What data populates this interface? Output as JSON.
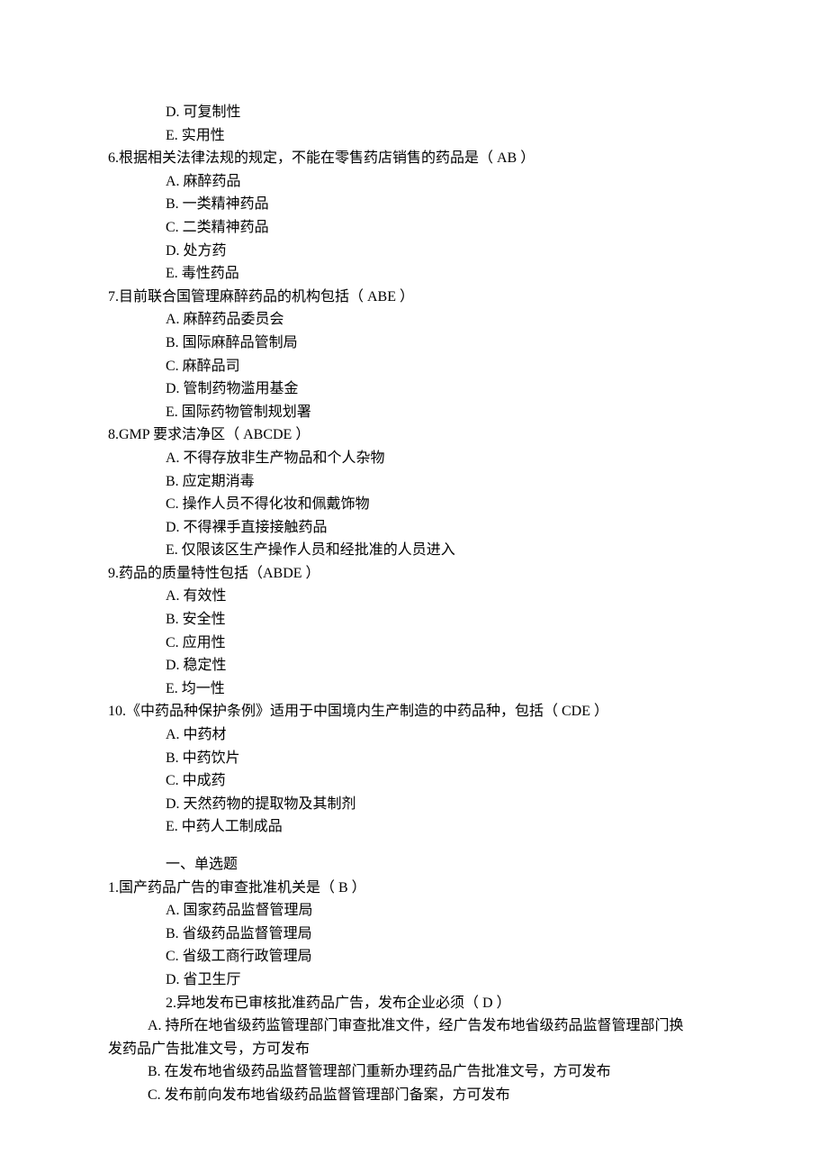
{
  "q_cont": {
    "opts": {
      "D": "D.  可复制性",
      "E": "E.  实用性"
    }
  },
  "q6": {
    "stem_num": "6.",
    "stem_rest": "根据相关法律法规的规定，不能在零售药店销售的药品是（    AB      ）",
    "opts": {
      "A": "A.  麻醉药品",
      "B": "B.  一类精神药品",
      "C": "C.  二类精神药品",
      "D": "D.  处方药",
      "E": "E.  毒性药品"
    }
  },
  "q7": {
    "stem_num": "7.",
    "stem_rest": "目前联合国管理麻醉药品的机构包括（  ABE   ）",
    "opts": {
      "A": "A.  麻醉药品委员会",
      "B": "B.  国际麻醉品管制局",
      "C": "C.  麻醉品司",
      "D": "D.  管制药物滥用基金",
      "E": "E.  国际药物管制规划署"
    }
  },
  "q8": {
    "stem_num": "8.",
    "stem_rest": "GMP 要求洁净区（  ABCDE    ）",
    "opts": {
      "A": "A.  不得存放非生产物品和个人杂物",
      "B": "B.  应定期消毒",
      "C": "C.  操作人员不得化妆和佩戴饰物",
      "D": "D.  不得裸手直接接触药品",
      "E": "E.  仅限该区生产操作人员和经批准的人员进入"
    }
  },
  "q9": {
    "stem_num": "9.",
    "stem_rest": "药品的质量特性包括（ABDE  ）",
    "opts": {
      "A": "A.  有效性",
      "B": "B.  安全性",
      "C": "C.  应用性",
      "D": "D.  稳定性",
      "E": "E.  均一性"
    }
  },
  "q10": {
    "stem_num": "10.",
    "stem_rest": "《中药品种保护条例》适用于中国境内生产制造的中药品种，包括（  CDE  ）",
    "opts": {
      "A": "A.  中药材",
      "B": "B.  中药饮片",
      "C": "C.  中成药",
      "D": "D.  天然药物的提取物及其制剂",
      "E": "E.  中药人工制成品"
    }
  },
  "section_heading": "一、单选题",
  "s1": {
    "stem_num": "1.",
    "stem_rest": "国产药品广告的审查批准机关是（    B          ）",
    "opts": {
      "A": "A.  国家药品监督管理局",
      "B": "B.  省级药品监督管理局",
      "C": "C.  省级工商行政管理局",
      "D": "D.  省卫生厅"
    }
  },
  "s2": {
    "stem": "2.异地发布已审核批准药品广告，发布企业必须（  D            ）",
    "optA_line1": "A.  持所在地省级药监管理部门审查批准文件，经广告发布地省级药品监督管理部门换",
    "optA_line2": "发药品广告批准文号，方可发布",
    "optB": "B.  在发布地省级药品监督管理部门重新办理药品广告批准文号，方可发布",
    "optC": "C.  发布前向发布地省级药品监督管理部门备案，方可发布"
  }
}
